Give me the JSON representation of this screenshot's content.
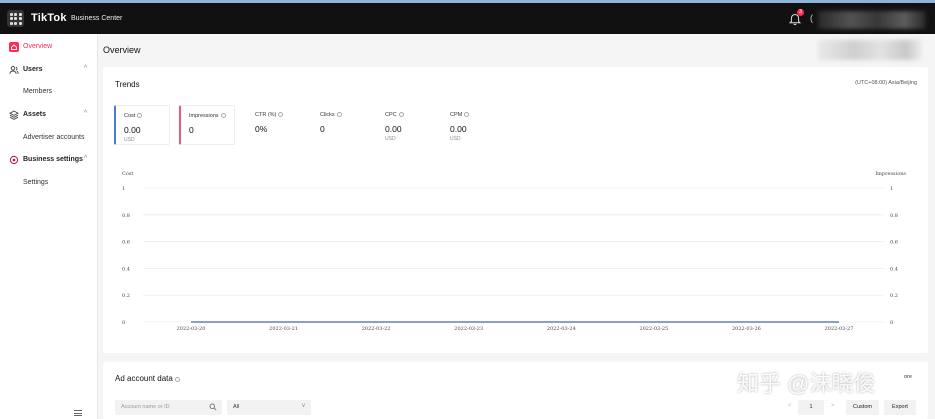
{
  "header": {
    "brand": "TikTok",
    "product": "Business Center",
    "notification_count": "3",
    "caret": "("
  },
  "sidebar": {
    "items": [
      {
        "label": "Overview",
        "icon": "overview-icon",
        "active": true
      },
      {
        "label": "Users",
        "icon": "users-icon"
      },
      {
        "label": "Members",
        "sub": true
      },
      {
        "label": "Assets",
        "icon": "assets-icon"
      },
      {
        "label": "Advertiser accounts",
        "sub": true
      },
      {
        "label": "Business settings",
        "icon": "settings-icon"
      },
      {
        "label": "Settings",
        "sub": true
      }
    ],
    "collapse_icon": "menu-collapse-icon"
  },
  "page": {
    "title": "Overview"
  },
  "trends": {
    "title": "Trends",
    "timezone": "(UTC+08:00) Asia/Beijing",
    "metrics": [
      {
        "label": "Cost",
        "value": "0.00",
        "unit": "USD"
      },
      {
        "label": "Impressions",
        "value": "0",
        "unit": ""
      },
      {
        "label": "CTR (%)",
        "value": "0%",
        "unit": ""
      },
      {
        "label": "Clicks",
        "value": "0",
        "unit": ""
      },
      {
        "label": "CPC",
        "value": "0.00",
        "unit": "USD"
      },
      {
        "label": "CPM",
        "value": "0.00",
        "unit": "USD"
      }
    ],
    "colors": {
      "cost": "#4a7bd8",
      "impressions": "#e85a7a"
    }
  },
  "chart_data": {
    "type": "line",
    "x": [
      "2022-03-20",
      "2022-03-21",
      "2022-03-22",
      "2022-03-23",
      "2022-03-24",
      "2022-03-25",
      "2022-03-26",
      "2022-03-27"
    ],
    "series": [
      {
        "name": "Cost",
        "values": [
          0,
          0,
          0,
          0,
          0,
          0,
          0,
          0
        ],
        "axis": "left"
      },
      {
        "name": "Impressions",
        "values": [
          0,
          0,
          0,
          0,
          0,
          0,
          0,
          0
        ],
        "axis": "right"
      }
    ],
    "ylabel": "Cost",
    "ylabel_right": "Impressions",
    "yticks": [
      "0",
      "0.2",
      "0.4",
      "0.6",
      "0.8",
      "1"
    ],
    "ylim": [
      0,
      1
    ],
    "grid": true
  },
  "ad_account": {
    "title": "Ad account data",
    "more": "ore",
    "search_placeholder": "Account name or ID",
    "filter_value": "All",
    "page": "1",
    "prev": "<",
    "next": ">",
    "custom_label": "Custom",
    "export_label": "Export"
  },
  "watermark": "知乎 @沫晓俊"
}
